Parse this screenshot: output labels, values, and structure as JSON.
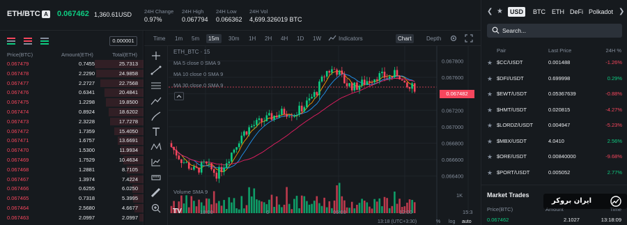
{
  "header": {
    "pair": "ETH/BTC",
    "badge": "A",
    "last_price": "0.067462",
    "last_price_usd": "1,360.61USD",
    "stats": [
      {
        "label": "24H Change",
        "value": "0.97%",
        "color": "#0ecb81"
      },
      {
        "label": "24H High",
        "value": "0.067794",
        "color": "#eaecef"
      },
      {
        "label": "24H Low",
        "value": "0.066362",
        "color": "#eaecef"
      },
      {
        "label": "24H Vol",
        "value": "4,699.326019 BTC",
        "color": "#eaecef"
      }
    ]
  },
  "orderbook": {
    "precision": "0.000001",
    "headers": {
      "price": "Price(BTC)",
      "amount": "Amount(ETH)",
      "total": "Total(ETH)"
    },
    "asks": [
      {
        "price": "0.067479",
        "amount": "0.7455",
        "total": "25.7313",
        "depth": 1.0
      },
      {
        "price": "0.067478",
        "amount": "2.2290",
        "total": "24.9858",
        "depth": 0.97
      },
      {
        "price": "0.067477",
        "amount": "2.2727",
        "total": "22.7568",
        "depth": 0.88
      },
      {
        "price": "0.067476",
        "amount": "0.6341",
        "total": "20.4841",
        "depth": 0.8
      },
      {
        "price": "0.067475",
        "amount": "1.2298",
        "total": "19.8500",
        "depth": 0.77
      },
      {
        "price": "0.067474",
        "amount": "0.8924",
        "total": "18.6202",
        "depth": 0.72
      },
      {
        "price": "0.067473",
        "amount": "2.3228",
        "total": "17.7278",
        "depth": 0.69
      },
      {
        "price": "0.067472",
        "amount": "1.7359",
        "total": "15.4050",
        "depth": 0.6
      },
      {
        "price": "0.067471",
        "amount": "1.6757",
        "total": "13.6691",
        "depth": 0.53
      },
      {
        "price": "0.067470",
        "amount": "1.5300",
        "total": "11.9934",
        "depth": 0.47
      },
      {
        "price": "0.067469",
        "amount": "1.7529",
        "total": "10.4634",
        "depth": 0.41
      },
      {
        "price": "0.067468",
        "amount": "1.2881",
        "total": "8.7105",
        "depth": 0.34
      },
      {
        "price": "0.067467",
        "amount": "1.3974",
        "total": "7.4224",
        "depth": 0.29
      },
      {
        "price": "0.067466",
        "amount": "0.6255",
        "total": "6.0250",
        "depth": 0.23
      },
      {
        "price": "0.067465",
        "amount": "0.7318",
        "total": "5.3995",
        "depth": 0.21
      },
      {
        "price": "0.067464",
        "amount": "2.5680",
        "total": "4.6677",
        "depth": 0.18
      },
      {
        "price": "0.067463",
        "amount": "2.0997",
        "total": "2.0997",
        "depth": 0.08
      }
    ]
  },
  "chart_toolbar": {
    "time_label": "Time",
    "intervals": [
      "1m",
      "5m",
      "15m",
      "30m",
      "1H",
      "2H",
      "4H",
      "1D",
      "1W"
    ],
    "active_interval": "15m",
    "indicators_label": "Indicators",
    "views": [
      "Chart",
      "Depth"
    ],
    "active_view": "Chart"
  },
  "chart": {
    "symbol_label": "ETH_BTC · 15",
    "ma_labels": [
      "MA 5 close 0 SMA 9",
      "MA 10 close 0 SMA 9",
      "MA 30 close 0 SMA 9"
    ],
    "volume_label": "Volume SMA 9",
    "volume_axis_label": "1K",
    "price_tag": "0.067482",
    "time_readout": "13:18 (UTC+3:30)",
    "log_label": "log",
    "auto_label": "auto",
    "pct_label": "%",
    "tv_logo": "TV",
    "colors": {
      "up": "#0ecb81",
      "down": "#f6465d",
      "ma5": "#ff9800",
      "ma10": "#2196f3",
      "ma30": "#e91e63"
    }
  },
  "chart_data": {
    "type": "candlestick",
    "title": "ETH_BTC · 15",
    "y_ticks": [
      0.0678,
      0.0676,
      0.0674,
      0.0672,
      0.067,
      0.0668,
      0.0666,
      0.0664
    ],
    "ylim": [
      0.06633,
      0.06788
    ],
    "x_ticks": [
      "18:00",
      "6",
      "06:00",
      "12:00",
      "15:3"
    ],
    "last_price": 0.067482
  },
  "markets": {
    "quote_tabs": [
      "USD",
      "BTC",
      "ETH",
      "DeFi",
      "Polkadot"
    ],
    "active_tab": "USD",
    "search_placeholder": "Search...",
    "headers": {
      "pair": "Pair",
      "price": "Last Price",
      "change": "24H %"
    },
    "rows": [
      {
        "pair": "$CC/USDT",
        "price": "0.001488",
        "change": "-1.26%",
        "up": false
      },
      {
        "pair": "$DFI/USDT",
        "price": "0.699998",
        "change": "0.29%",
        "up": true
      },
      {
        "pair": "$EWT/USDT",
        "price": "0.05367639",
        "change": "-0.88%",
        "up": false
      },
      {
        "pair": "$HMT/USDT",
        "price": "0.020815",
        "change": "-4.27%",
        "up": false
      },
      {
        "pair": "$LORDZ/USDT",
        "price": "0.004947",
        "change": "-5.23%",
        "up": false
      },
      {
        "pair": "$MBX/USDT",
        "price": "4.0410",
        "change": "2.56%",
        "up": true
      },
      {
        "pair": "$ORE/USDT",
        "price": "0.00840000",
        "change": "-9.68%",
        "up": false
      },
      {
        "pair": "$PORT/USDT",
        "price": "0.005052",
        "change": "2.77%",
        "up": true
      }
    ]
  },
  "market_trades": {
    "title": "Market Trades",
    "headers": {
      "price": "Price(BTC)",
      "amount": "Amount",
      "time": "Time"
    },
    "first": {
      "price": "0.067462",
      "amount": "2.1027",
      "time": "13:18:09"
    }
  },
  "watermark": {
    "text": "ایران بروکر"
  }
}
